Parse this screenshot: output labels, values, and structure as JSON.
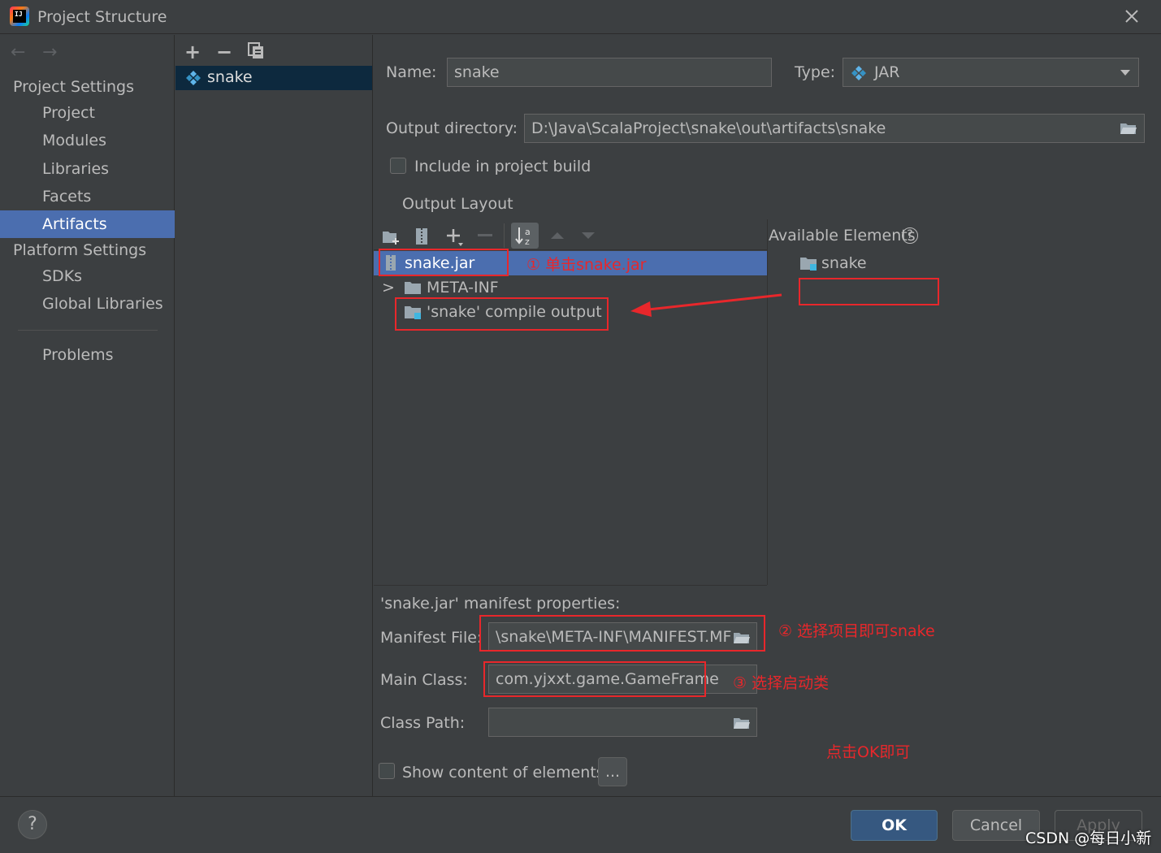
{
  "window": {
    "title": "Project Structure"
  },
  "nav": {
    "back": "←",
    "forward": "→",
    "project_settings": "Project Settings",
    "project_items": [
      "Project",
      "Modules",
      "Libraries",
      "Facets",
      "Artifacts"
    ],
    "platform_settings": "Platform Settings",
    "platform_items": [
      "SDKs",
      "Global Libraries"
    ],
    "problems": "Problems",
    "selected": "Artifacts"
  },
  "artifacts": {
    "toolbar": {
      "add": "+",
      "remove": "−"
    },
    "items": [
      "snake"
    ]
  },
  "form": {
    "name_label": "Name:",
    "name_value": "snake",
    "type_label": "Type:",
    "type_value": "JAR",
    "output_dir_label": "Output directory:",
    "output_dir_value": "D:\\Java\\ScalaProject\\snake\\out\\artifacts\\snake",
    "include_build_label": "Include in project build",
    "include_build_checked": false,
    "output_layout_title": "Output Layout"
  },
  "layout_tree": {
    "items": [
      "snake.jar",
      "META-INF",
      "'snake' compile output"
    ],
    "expand_glyph": ">"
  },
  "available": {
    "title": "Available Elements",
    "help": "?",
    "items": [
      "snake"
    ]
  },
  "manifest": {
    "title": "'snake.jar' manifest properties:",
    "file_label": "Manifest File:",
    "file_value": "\\snake\\META-INF\\MANIFEST.MF",
    "main_class_label": "Main Class:",
    "main_class_value": "com.yjxxt.game.GameFrame",
    "class_path_label": "Class Path:",
    "class_path_value": "",
    "show_content_label": "Show content of elements",
    "ellipsis": "..."
  },
  "annotations": {
    "step1": "① 单击snake.jar",
    "step2": "② 选择项目即可snake",
    "step3": "③ 选择启动类",
    "ok_note": "点击OK即可"
  },
  "buttons": {
    "ok": "OK",
    "cancel": "Cancel",
    "apply": "Apply",
    "help": "?"
  },
  "watermark": "CSDN @每日小新",
  "colors": {
    "selection": "#4b6eaf",
    "annotation": "#e8272b",
    "background": "#3c3f41",
    "ok_button": "#365880"
  }
}
